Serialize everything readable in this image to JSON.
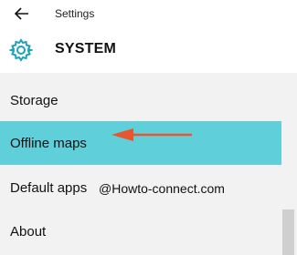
{
  "header": {
    "app_title": "Settings",
    "section_title": "SYSTEM"
  },
  "nav": {
    "items": [
      {
        "label": "Storage"
      },
      {
        "label": "Offline maps",
        "selected": true
      },
      {
        "label": "Default apps"
      },
      {
        "label": "About"
      }
    ]
  },
  "watermark": "@Howto-connect.com",
  "colors": {
    "accent": "#5fcfda",
    "gear_icon": "#1aa3b3",
    "annotation_arrow": "#e8552f",
    "header_bg": "#ffffff",
    "nav_bg": "#f2f2f2"
  },
  "icons": {
    "back": "back-arrow-icon",
    "section": "gear-icon",
    "annotation": "red-arrow-icon"
  }
}
